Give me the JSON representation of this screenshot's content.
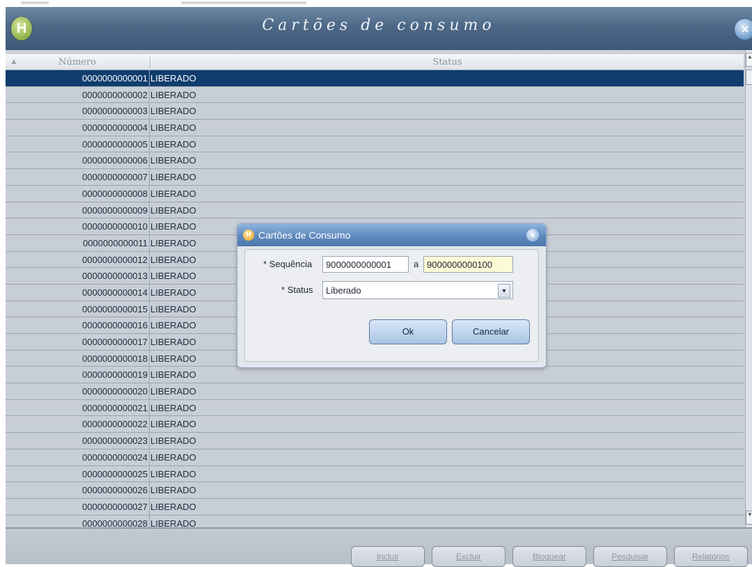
{
  "window": {
    "title": "Cartões de consumo",
    "logo_glyph": "H",
    "close_glyph": "×"
  },
  "grid": {
    "sort_glyph": "▲",
    "columns": [
      "Número",
      "Status"
    ],
    "selected_index": 0,
    "rows": [
      {
        "numero": "0000000000001",
        "status": "LIBERADO"
      },
      {
        "numero": "0000000000002",
        "status": "LIBERADO"
      },
      {
        "numero": "0000000000003",
        "status": "LIBERADO"
      },
      {
        "numero": "0000000000004",
        "status": "LIBERADO"
      },
      {
        "numero": "0000000000005",
        "status": "LIBERADO"
      },
      {
        "numero": "0000000000006",
        "status": "LIBERADO"
      },
      {
        "numero": "0000000000007",
        "status": "LIBERADO"
      },
      {
        "numero": "0000000000008",
        "status": "LIBERADO"
      },
      {
        "numero": "0000000000009",
        "status": "LIBERADO"
      },
      {
        "numero": "0000000000010",
        "status": "LIBERADO"
      },
      {
        "numero": "0000000000011",
        "status": "LIBERADO"
      },
      {
        "numero": "0000000000012",
        "status": "LIBERADO"
      },
      {
        "numero": "0000000000013",
        "status": "LIBERADO"
      },
      {
        "numero": "0000000000014",
        "status": "LIBERADO"
      },
      {
        "numero": "0000000000015",
        "status": "LIBERADO"
      },
      {
        "numero": "0000000000016",
        "status": "LIBERADO"
      },
      {
        "numero": "0000000000017",
        "status": "LIBERADO"
      },
      {
        "numero": "0000000000018",
        "status": "LIBERADO"
      },
      {
        "numero": "0000000000019",
        "status": "LIBERADO"
      },
      {
        "numero": "0000000000020",
        "status": "LIBERADO"
      },
      {
        "numero": "0000000000021",
        "status": "LIBERADO"
      },
      {
        "numero": "0000000000022",
        "status": "LIBERADO"
      },
      {
        "numero": "0000000000023",
        "status": "LIBERADO"
      },
      {
        "numero": "0000000000024",
        "status": "LIBERADO"
      },
      {
        "numero": "0000000000025",
        "status": "LIBERADO"
      },
      {
        "numero": "0000000000026",
        "status": "LIBERADO"
      },
      {
        "numero": "0000000000027",
        "status": "LIBERADO"
      },
      {
        "numero": "0000000000028",
        "status": "LIBERADO"
      }
    ]
  },
  "footer": {
    "buttons": [
      "Incluir",
      "Excluir",
      "Bloquear",
      "Pesquisar",
      "Relatórios"
    ]
  },
  "dialog": {
    "title": "Cartões de Consumo",
    "sequencia_label": "* Sequência",
    "sequencia_from": "9000000000001",
    "sequencia_sep": "a",
    "sequencia_to": "9000000000100",
    "status_label": "* Status",
    "status_value": "Liberado",
    "ok_label": "Ok",
    "cancel_label": "Cancelar"
  },
  "colors": {
    "titlebar": "#4d6886",
    "selected_row": "#0f3d6e",
    "grid_bg": "#c8ced7",
    "dialog_title": "#5f89bd",
    "highlight_input": "#fdfbd6"
  }
}
